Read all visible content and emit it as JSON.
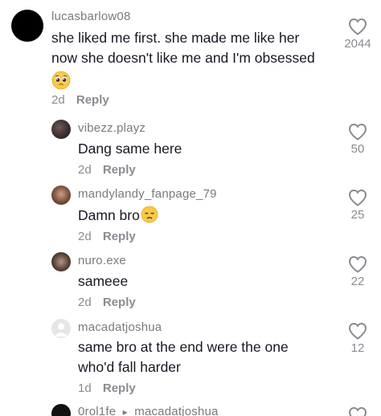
{
  "comments": [
    {
      "username": "lucasbarlow08",
      "text_line1": "she liked me first. she made me like her",
      "text_line2": "now she doesn't like me and I'm obsessed",
      "emoji": "pleading-face",
      "time": "2d",
      "reply_label": "Reply",
      "likes": "2044"
    }
  ],
  "replies": [
    {
      "username": "vibezz.playz",
      "text": "Dang same here",
      "time": "2d",
      "reply_label": "Reply",
      "likes": "50"
    },
    {
      "username": "mandylandy_fanpage_79",
      "text": "Damn bro",
      "emoji": "disappointed-face",
      "time": "2d",
      "reply_label": "Reply",
      "likes": "25"
    },
    {
      "username": "nuro.exe",
      "text": "sameee",
      "time": "2d",
      "reply_label": "Reply",
      "likes": "22"
    },
    {
      "username": "macadatjoshua",
      "text_line1": "same bro at the end were the one",
      "text_line2": "who'd fall harder",
      "time": "1d",
      "reply_label": "Reply",
      "likes": "12"
    },
    {
      "username": "0rol1fe",
      "reply_to": "macadatjoshua",
      "reply_arrow": "▸"
    }
  ],
  "colors": {
    "text": "#161823",
    "secondary": "#8a8b91",
    "username": "#7a7a80"
  },
  "icons": [
    "heart-outline-icon",
    "pleading-face-emoji",
    "disappointed-face-emoji",
    "default-avatar-icon",
    "reply-arrow-icon"
  ]
}
